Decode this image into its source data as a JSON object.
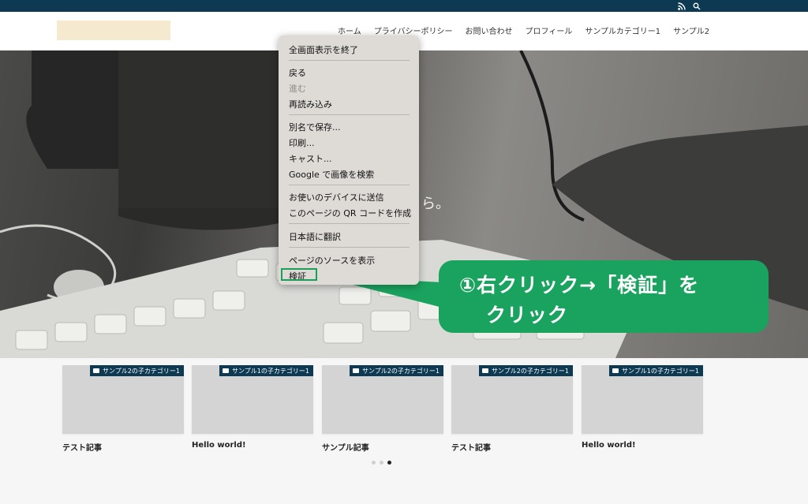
{
  "nav": {
    "items": [
      "ホーム",
      "プライバシーポリシー",
      "お問い合わせ",
      "プロフィール",
      "サンプルカテゴリー1",
      "サンプル2"
    ]
  },
  "hero": {
    "partial_text": "ら。"
  },
  "context_menu": {
    "items": [
      {
        "label": "全画面表示を終了",
        "enabled": true
      },
      {
        "label": "戻る",
        "enabled": true
      },
      {
        "label": "進む",
        "enabled": false
      },
      {
        "label": "再読み込み",
        "enabled": true
      },
      {
        "label": "別名で保存...",
        "enabled": true
      },
      {
        "label": "印刷...",
        "enabled": true
      },
      {
        "label": "キャスト...",
        "enabled": true
      },
      {
        "label": "Google で画像を検索",
        "enabled": true
      },
      {
        "label": "お使いのデバイスに送信",
        "enabled": true
      },
      {
        "label": "このページの QR コードを作成",
        "enabled": true
      },
      {
        "label": "日本語に翻訳",
        "enabled": true
      },
      {
        "label": "ページのソースを表示",
        "enabled": true
      },
      {
        "label": "検証",
        "enabled": true
      }
    ]
  },
  "callout": {
    "line1": "①右クリック→「検証」を",
    "line2": "クリック",
    "color": "#1aa35e"
  },
  "cards": [
    {
      "category": "サンプル2の子カテゴリー1",
      "title": "テスト記事"
    },
    {
      "category": "サンプル1の子カテゴリー1",
      "title": "Hello world!"
    },
    {
      "category": "サンプル2の子カテゴリー1",
      "title": "サンプル記事"
    },
    {
      "category": "サンプル2の子カテゴリー1",
      "title": "テスト記事"
    },
    {
      "category": "サンプル1の子カテゴリー1",
      "title": "Hello world!"
    }
  ],
  "pagination": {
    "total": 3,
    "active_index": 2
  },
  "colors": {
    "topbar": "#0d3a52",
    "logo_placeholder": "#f5ead0",
    "accent_green": "#1aa35e"
  },
  "icons": {
    "topbar": [
      "rss-icon",
      "search-icon"
    ],
    "card_tag": "folder-icon"
  }
}
